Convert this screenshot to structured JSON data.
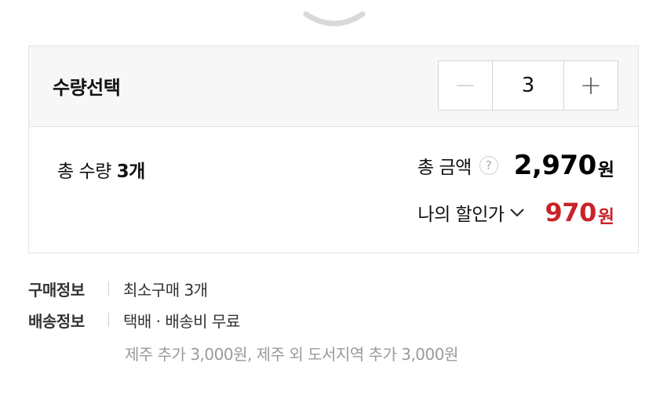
{
  "quantity_section": {
    "title": "수량선택",
    "minus_symbol": "−",
    "value": "3",
    "plus_symbol": "+"
  },
  "summary": {
    "total_qty_prefix": "총 수량 ",
    "total_qty_value": "3개",
    "total_amount_label": "총 금액",
    "help_symbol": "?",
    "total_amount_value": "2,970",
    "total_amount_unit": "원",
    "discount_label": "나의 할인가",
    "discount_value": "970",
    "discount_unit": "원"
  },
  "info": {
    "purchase_label": "구매정보",
    "purchase_value": "최소구매 3개",
    "shipping_label": "배송정보",
    "shipping_value": "택배 · 배송비 무료",
    "shipping_note": "제주 추가 3,000원, 제주 외 도서지역 추가 3,000원"
  },
  "colors": {
    "discount": "#c8242b",
    "panel_header_bg": "#f7f7f7",
    "border": "#e3e3e3"
  },
  "icons": [
    "collapse-chevron-icon",
    "help-icon",
    "chevron-down-icon"
  ]
}
